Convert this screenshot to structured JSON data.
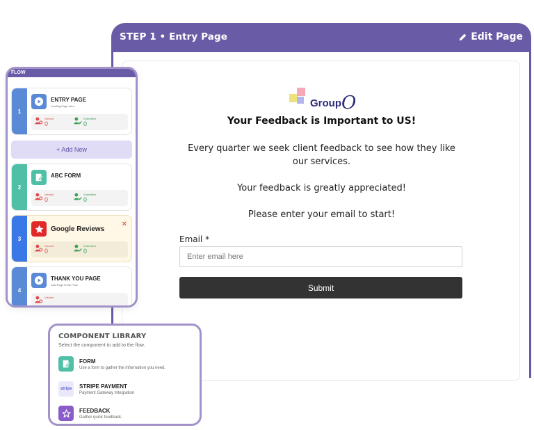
{
  "main": {
    "step_title": "STEP 1 • Entry Page",
    "edit_label": "Edit Page",
    "logo": {
      "text": "Group",
      "suffix": "O",
      "square_colors": [
        "#f0e27a",
        "#f3a9b6",
        "#b3b6ee",
        "#c6b2f0"
      ]
    },
    "form": {
      "title": "Your Feedback is Important to US!",
      "paragraph_1": "Every quarter we seek client feedback to see how they like our services.",
      "paragraph_2": "Your feedback is greatly appreciated!",
      "paragraph_3": "Please enter your email to start!",
      "email_label": "Email *",
      "email_placeholder": "Enter email here",
      "email_value": "",
      "submit_label": "Submit"
    }
  },
  "flow": {
    "header": "FLOW",
    "add_new_label": "+  Add New",
    "items": [
      {
        "number": "1",
        "title": "ENTRY PAGE",
        "subtitle": "Landing Page Intro",
        "icon": "play-icon",
        "viewed_label": "Viewed",
        "viewed_value": "0",
        "submitted_label": "Submitted",
        "submitted_value": "0",
        "stripe_color": "#5a8ad6",
        "icon_color": "#5a8ad6"
      },
      {
        "number": "2",
        "title": "ABC FORM",
        "subtitle": "",
        "icon": "form-icon",
        "viewed_label": "Viewed",
        "viewed_value": "0",
        "submitted_label": "Submitted",
        "submitted_value": "0",
        "stripe_color": "#4fbfa6",
        "icon_color": "#4fbfa6"
      },
      {
        "number": "3",
        "title": "Google Reviews",
        "subtitle": "",
        "icon": "star-icon",
        "viewed_label": "Viewed",
        "viewed_value": "0",
        "submitted_label": "Submitted",
        "submitted_value": "0",
        "stripe_color": "#3b78e7",
        "icon_color": "#e02a2a",
        "close_label": "✕"
      },
      {
        "number": "4",
        "title": "THANK YOU PAGE",
        "subtitle": "Last Page of the Flow",
        "icon": "play-icon",
        "viewed_label": "Viewed",
        "viewed_value": "",
        "submitted_label": "",
        "submitted_value": "",
        "stripe_color": "#5a8ad6",
        "icon_color": "#5a8ad6"
      }
    ]
  },
  "library": {
    "title": "COMPONENT LIBRARY",
    "subtitle": "Select the component to add to the flow.",
    "items": [
      {
        "name": "FORM",
        "desc": "Use a form to gather the information you need.",
        "icon": "form-icon",
        "color": "#4fbfa6"
      },
      {
        "name": "STRIPE PAYMENT",
        "desc": "Payment Gateway Integration",
        "icon": "stripe-icon",
        "icon_text": "stripe",
        "color": "#e9e9fb"
      },
      {
        "name": "FEEDBACK",
        "desc": "Gather quick feedback.",
        "icon": "feedback-star-icon",
        "color": "#8a5cc9"
      }
    ]
  },
  "colors": {
    "brand_purple": "#6a5ba6",
    "panel_border": "#a292c9",
    "viewed_red": "#e04848",
    "submitted_green": "#3aa055"
  }
}
